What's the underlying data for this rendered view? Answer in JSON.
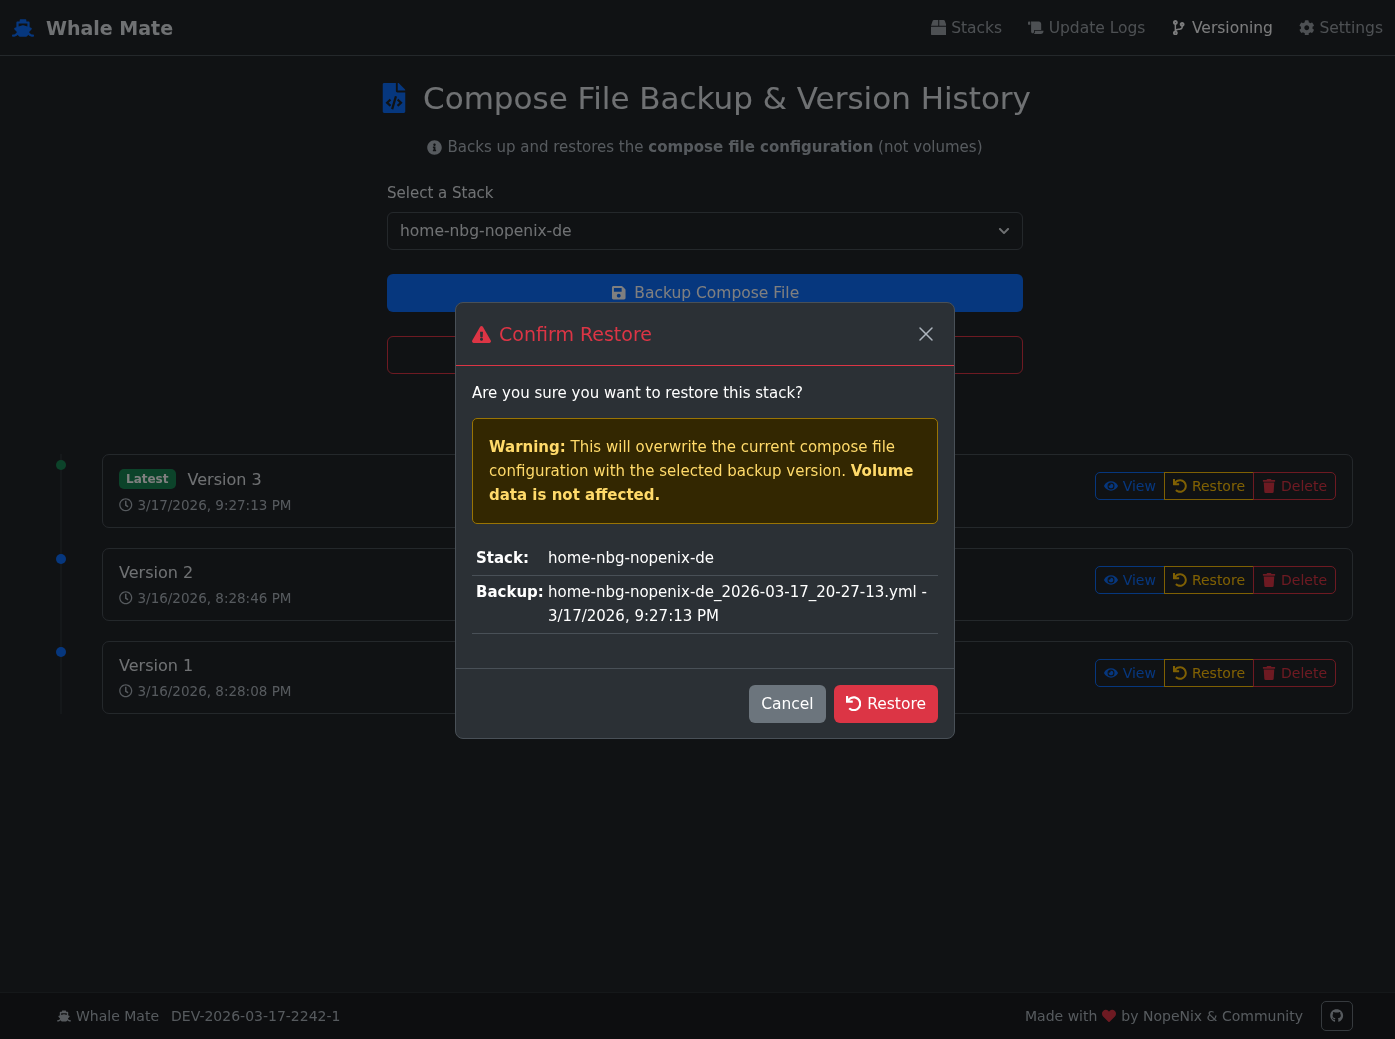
{
  "navbar": {
    "brand": "Whale Mate",
    "items": [
      {
        "label": "Stacks",
        "selected": false
      },
      {
        "label": "Update Logs",
        "selected": false
      },
      {
        "label": "Versioning",
        "selected": true
      },
      {
        "label": "Settings",
        "selected": false
      }
    ]
  },
  "page": {
    "title": "Compose File Backup & Version History",
    "info": "Backs up and restores the **compose file configuration** (not volumes)",
    "select_label": "Select a Stack",
    "select_value": "home-nbg-nopenix-de",
    "backup_button": "Backup Compose File"
  },
  "versions": [
    {
      "name": "Version 3",
      "badge": "Latest",
      "latest": true,
      "time": "3/17/2026, 9:27:13 PM",
      "actions": [
        "View",
        "Restore",
        "Delete"
      ]
    },
    {
      "name": "Version 2",
      "latest": false,
      "time": "3/16/2026, 8:28:46 PM",
      "actions": [
        "View",
        "Restore",
        "Delete"
      ]
    },
    {
      "name": "Version 1",
      "latest": false,
      "time": "3/16/2026, 8:28:08 PM",
      "actions": [
        "View",
        "Restore",
        "Delete"
      ]
    }
  ],
  "modal": {
    "title": "Confirm Restore",
    "question": "Are you sure you want to restore this stack?",
    "warning": "**Warning:** This will overwrite the current compose file configuration with the selected backup version. **Volume data is not affected.**",
    "details": [
      {
        "label": "Stack:",
        "value": "home-nbg-nopenix-de"
      },
      {
        "label": "Backup:",
        "value": "home-nbg-nopenix-de_2026-03-17_20-27-13.yml - 3/17/2026, 9:27:13 PM"
      }
    ],
    "cancel": "Cancel",
    "confirm": "Restore"
  },
  "footer": {
    "brand": "Whale Mate",
    "version": "DEV-2026-03-17-2242-1",
    "made_with": "Made with",
    "by": "by NopeNix & Community"
  }
}
